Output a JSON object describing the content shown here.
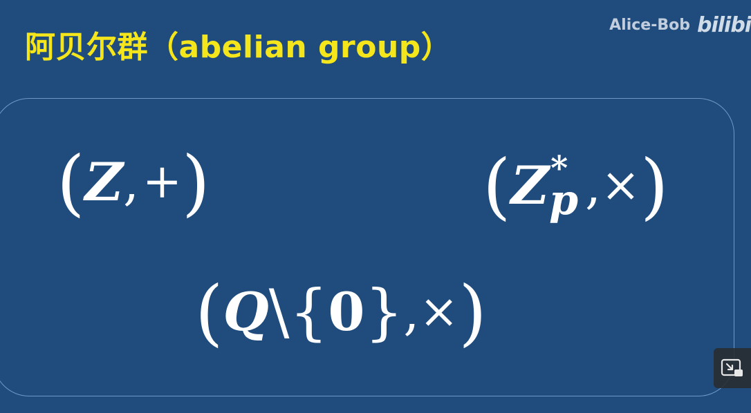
{
  "slide": {
    "title": "阿贝尔群（abelian group）",
    "title_color": "#f5e51b",
    "background_color": "#1f4c7c"
  },
  "watermark": {
    "text": "Alice-Bob",
    "logo": "bilibili"
  },
  "formulas": {
    "f1": {
      "lparen": "(",
      "set": "Z",
      "comma": ",",
      "op": "+",
      "rparen": ")"
    },
    "f2": {
      "lparen": "(",
      "set": "Z",
      "sup": "*",
      "sub": "p",
      "comma": ",",
      "op": "×",
      "rparen": ")"
    },
    "f3": {
      "lparen": "(",
      "set": "Q",
      "backslash": "\\",
      "lbrace": "{",
      "zero": "0",
      "rbrace": "}",
      "comma": ",",
      "op": "×",
      "rparen": ")"
    }
  },
  "controls": {
    "pip_icon": "picture-in-picture-exit-icon"
  }
}
